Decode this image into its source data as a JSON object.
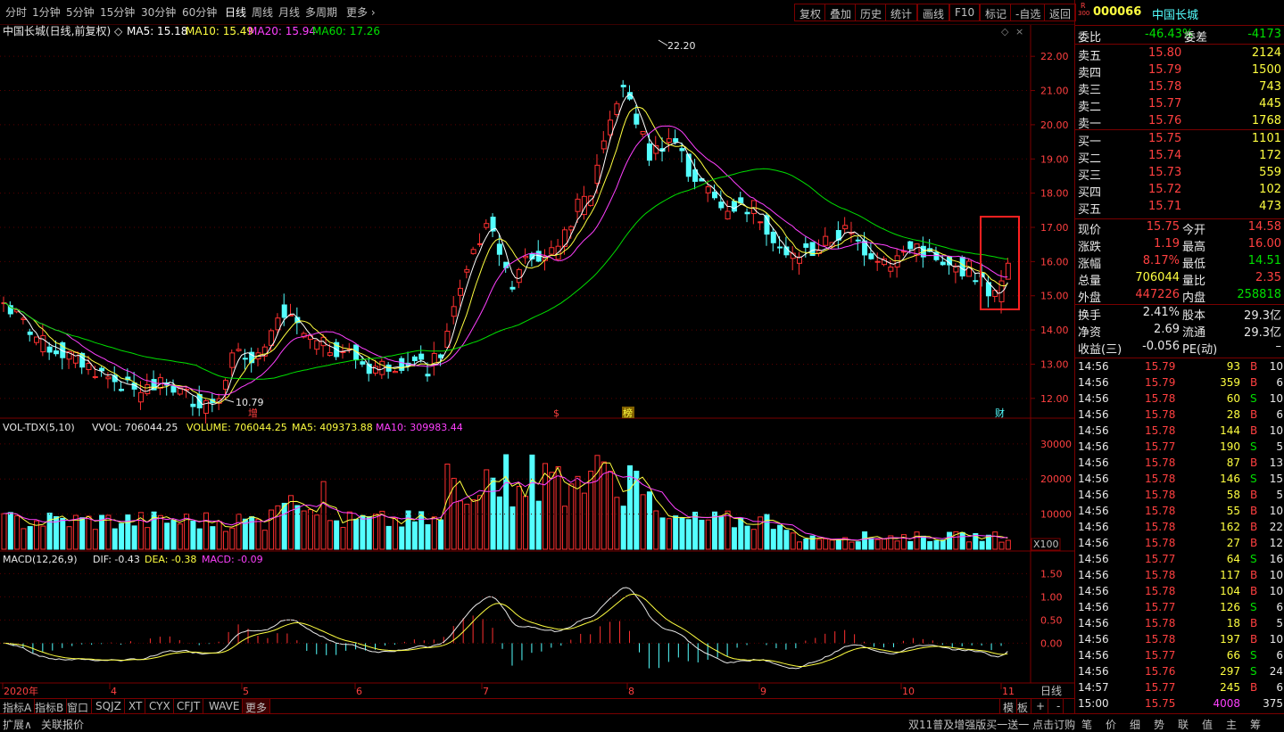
{
  "periods": [
    "分时",
    "1分钟",
    "5分钟",
    "15分钟",
    "30分钟",
    "60分钟",
    "日线",
    "周线",
    "月线",
    "多周期",
    "更多"
  ],
  "active_period": "日线",
  "tools": [
    "复权",
    "叠加",
    "历史",
    "统计",
    "画线",
    "F10",
    "标记",
    "-自选",
    "返回"
  ],
  "chart": {
    "title": "中国长城(日线,前复权)",
    "ma": [
      {
        "label": "MA5: 15.18",
        "color": "#ffffff"
      },
      {
        "label": "MA10: 15.49",
        "color": "#ffff40"
      },
      {
        "label": "MA20: 15.94",
        "color": "#ff40ff"
      },
      {
        "label": "MA60: 17.26",
        "color": "#00e000"
      }
    ],
    "price_ticks": [
      "22.00",
      "21.00",
      "20.00",
      "19.00",
      "18.00",
      "17.00",
      "16.00",
      "15.00",
      "14.00",
      "13.00",
      "12.00"
    ],
    "price_range": [
      11.5,
      22.5
    ],
    "high_label": "22.20",
    "low_label": "10.79",
    "markers": [
      "增",
      "$",
      "榜",
      "财"
    ],
    "vol_title": "VOL-TDX(5,10)",
    "vol_vals": [
      {
        "label": "VVOL: 706044.25",
        "color": "#e8e8e8"
      },
      {
        "label": "VOLUME: 706044.25",
        "color": "#ffff40"
      },
      {
        "label": "MA5: 409373.88",
        "color": "#ffff40"
      },
      {
        "label": "MA10: 309983.44",
        "color": "#ff40ff"
      }
    ],
    "vol_ticks": [
      "30000",
      "20000",
      "10000"
    ],
    "vol_unit": "X100",
    "macd_title": "MACD(12,26,9)",
    "macd_vals": [
      {
        "label": "DIF: -0.43",
        "color": "#e8e8e8"
      },
      {
        "label": "DEA: -0.38",
        "color": "#ffff40"
      },
      {
        "label": "MACD: -0.09",
        "color": "#ff40ff"
      }
    ],
    "macd_ticks": [
      "1.50",
      "1.00",
      "0.50",
      "0.00"
    ],
    "date_labels": [
      "2020年",
      "4",
      "5",
      "6",
      "7",
      "8",
      "9",
      "10",
      "11"
    ],
    "period_label": "日线"
  },
  "stock": {
    "code": "000066",
    "name": "中国长城",
    "badge_top": "R",
    "badge_bottom": "300"
  },
  "commission": {
    "ratio_label": "委比",
    "ratio": "-46.43%",
    "diff_label": "委差",
    "diff": "-4173"
  },
  "asks": [
    {
      "label": "卖五",
      "price": "15.80",
      "vol": "2124"
    },
    {
      "label": "卖四",
      "price": "15.79",
      "vol": "1500"
    },
    {
      "label": "卖三",
      "price": "15.78",
      "vol": "743"
    },
    {
      "label": "卖二",
      "price": "15.77",
      "vol": "445"
    },
    {
      "label": "卖一",
      "price": "15.76",
      "vol": "1768"
    }
  ],
  "bids": [
    {
      "label": "买一",
      "price": "15.75",
      "vol": "1101"
    },
    {
      "label": "买二",
      "price": "15.74",
      "vol": "172"
    },
    {
      "label": "买三",
      "price": "15.73",
      "vol": "559"
    },
    {
      "label": "买四",
      "price": "15.72",
      "vol": "102"
    },
    {
      "label": "买五",
      "price": "15.71",
      "vol": "473"
    }
  ],
  "quote": [
    {
      "l1": "现价",
      "v1": "15.75",
      "c1": "red",
      "l2": "今开",
      "v2": "14.58",
      "c2": "red"
    },
    {
      "l1": "涨跌",
      "v1": "1.19",
      "c1": "red",
      "l2": "最高",
      "v2": "16.00",
      "c2": "red"
    },
    {
      "l1": "涨幅",
      "v1": "8.17%",
      "c1": "red",
      "l2": "最低",
      "v2": "14.51",
      "c2": "green"
    },
    {
      "l1": "总量",
      "v1": "706044",
      "c1": "yellow",
      "l2": "量比",
      "v2": "2.35",
      "c2": "red"
    },
    {
      "l1": "外盘",
      "v1": "447226",
      "c1": "red",
      "l2": "内盘",
      "v2": "258818",
      "c2": "green"
    }
  ],
  "fundamentals": [
    {
      "l1": "换手",
      "v1": "2.41%",
      "l2": "股本",
      "v2": "29.3亿"
    },
    {
      "l1": "净资",
      "v1": "2.69",
      "l2": "流通",
      "v2": "29.3亿"
    },
    {
      "l1": "收益(三)",
      "v1": "-0.056",
      "l2": "PE(动)",
      "v2": "–"
    }
  ],
  "ticks": [
    {
      "t": "14:56",
      "p": "15.79",
      "v": "93",
      "d": "B",
      "n": "10"
    },
    {
      "t": "14:56",
      "p": "15.79",
      "v": "359",
      "d": "B",
      "n": "6"
    },
    {
      "t": "14:56",
      "p": "15.78",
      "v": "60",
      "d": "S",
      "n": "10"
    },
    {
      "t": "14:56",
      "p": "15.78",
      "v": "28",
      "d": "B",
      "n": "6"
    },
    {
      "t": "14:56",
      "p": "15.78",
      "v": "144",
      "d": "B",
      "n": "10"
    },
    {
      "t": "14:56",
      "p": "15.77",
      "v": "190",
      "d": "S",
      "n": "5"
    },
    {
      "t": "14:56",
      "p": "15.78",
      "v": "87",
      "d": "B",
      "n": "13"
    },
    {
      "t": "14:56",
      "p": "15.78",
      "v": "146",
      "d": "S",
      "n": "15"
    },
    {
      "t": "14:56",
      "p": "15.78",
      "v": "58",
      "d": "B",
      "n": "5"
    },
    {
      "t": "14:56",
      "p": "15.78",
      "v": "55",
      "d": "B",
      "n": "10"
    },
    {
      "t": "14:56",
      "p": "15.78",
      "v": "162",
      "d": "B",
      "n": "22"
    },
    {
      "t": "14:56",
      "p": "15.78",
      "v": "27",
      "d": "B",
      "n": "12"
    },
    {
      "t": "14:56",
      "p": "15.77",
      "v": "64",
      "d": "S",
      "n": "16"
    },
    {
      "t": "14:56",
      "p": "15.78",
      "v": "117",
      "d": "B",
      "n": "10"
    },
    {
      "t": "14:56",
      "p": "15.78",
      "v": "104",
      "d": "B",
      "n": "10"
    },
    {
      "t": "14:56",
      "p": "15.77",
      "v": "126",
      "d": "S",
      "n": "6"
    },
    {
      "t": "14:56",
      "p": "15.78",
      "v": "18",
      "d": "B",
      "n": "5"
    },
    {
      "t": "14:56",
      "p": "15.78",
      "v": "197",
      "d": "B",
      "n": "10"
    },
    {
      "t": "14:56",
      "p": "15.77",
      "v": "66",
      "d": "S",
      "n": "6"
    },
    {
      "t": "14:56",
      "p": "15.76",
      "v": "297",
      "d": "S",
      "n": "24"
    },
    {
      "t": "14:57",
      "p": "15.77",
      "v": "245",
      "d": "B",
      "n": "6"
    },
    {
      "t": "15:00",
      "p": "15.75",
      "v": "4008",
      "d": "",
      "n": "375"
    }
  ],
  "bottom_tabs": [
    "指标A",
    "指标B",
    "窗口",
    "SQJZ",
    "XT",
    "CYX",
    "CFJT",
    "WAVE",
    "更多"
  ],
  "bottom_right": [
    "模",
    "板",
    "+",
    "-"
  ],
  "status": {
    "left1": "扩展∧",
    "left2": "关联报价",
    "ad": "双11普及增强版买一送一 点击订购",
    "tabs": [
      "笔",
      "价",
      "细",
      "势",
      "联",
      "值",
      "主",
      "筹"
    ]
  }
}
